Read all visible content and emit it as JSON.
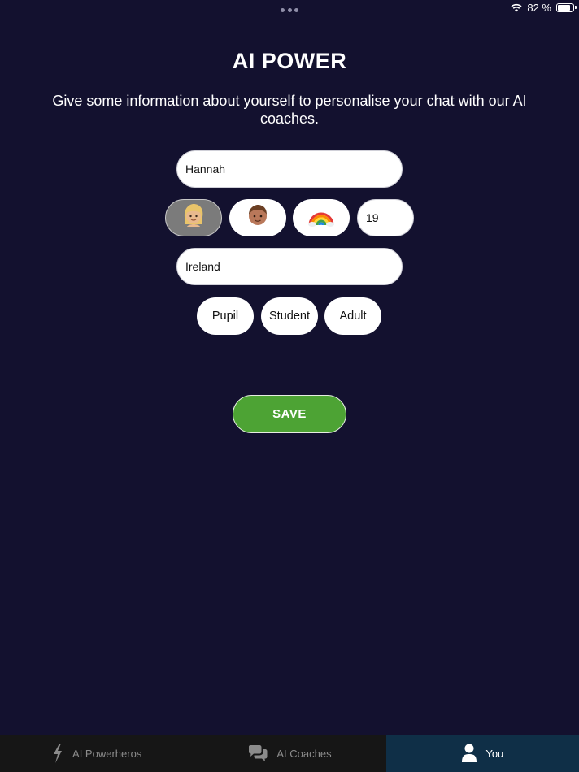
{
  "status_bar": {
    "battery_text": "82 %",
    "battery_level": 0.82
  },
  "header": {
    "title": "AI POWER",
    "subtitle": "Give some information about yourself to personalise your chat with our AI coaches."
  },
  "form": {
    "name_value": "Hannah",
    "avatars": [
      {
        "name": "blonde-person-avatar",
        "glyph": "👱🏼‍♀️",
        "selected": true
      },
      {
        "name": "boy-avatar",
        "glyph": "👦🏽",
        "selected": false
      },
      {
        "name": "rainbow-avatar",
        "glyph": "🌈",
        "selected": false
      }
    ],
    "age_value": "19",
    "country_value": "Ireland",
    "roles": [
      "Pupil",
      "Student",
      "Adult"
    ],
    "save_label": "SAVE"
  },
  "tabs": [
    {
      "label": "AI Powerheros",
      "icon": "lightning-icon",
      "active": false
    },
    {
      "label": "AI Coaches",
      "icon": "chat-bubbles-icon",
      "active": false
    },
    {
      "label": "You",
      "icon": "person-icon",
      "active": true
    }
  ],
  "colors": {
    "background": "#13112f",
    "accent_green": "#4da334",
    "active_tab": "#0f2f47",
    "tab_bar": "#161616"
  }
}
